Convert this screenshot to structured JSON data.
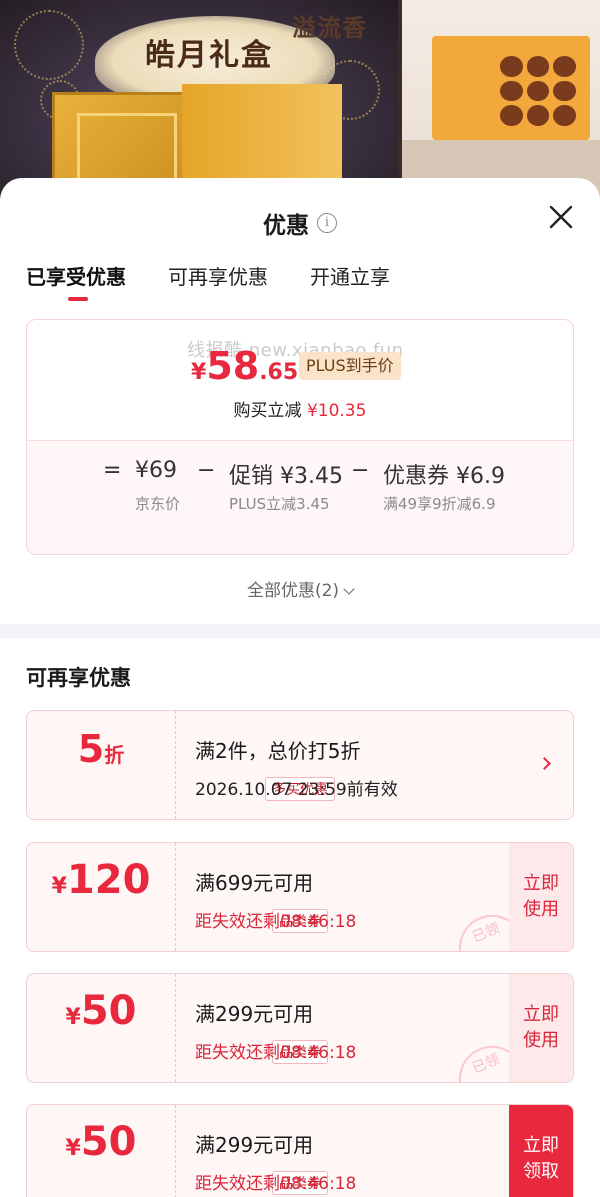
{
  "banner": {
    "title": "皓月礼盒",
    "brand": "溢流香"
  },
  "sheet": {
    "title": "优惠",
    "tabs": [
      "已享受优惠",
      "可再享优惠",
      "开通立享"
    ],
    "active_tab_index": 0
  },
  "summary": {
    "watermark": "线报酷 new.xianbao.fun",
    "currency": "¥",
    "price_int": "58",
    "price_dec": ".65",
    "plus_badge": "PLUS到手价",
    "reduce_label": "购买立减",
    "reduce_value": "¥10.35",
    "breakdown": {
      "eq": "=",
      "base_value": "¥69",
      "base_label": "京东价",
      "minus1": "−",
      "promo_value": "促销 ¥3.45",
      "promo_label": "PLUS立减3.45",
      "minus2": "−",
      "coupon_value": "优惠券 ¥6.9",
      "coupon_label": "满49享9折减6.9"
    }
  },
  "all_discounts_label": "全部优惠(2)",
  "more_section_title": "可再享优惠",
  "coupons": [
    {
      "big": "5",
      "big_unit": "折",
      "tag": "多买优惠",
      "title": "满2件，总价打5折",
      "sub": "2026.10.07 23:59前有效",
      "action": ""
    },
    {
      "big_prefix": "¥",
      "big": "120",
      "tag": "品类券",
      "title": "满699元可用",
      "sub": "距失效还剩08:46:18",
      "action": "立即使用",
      "stamp": "已领"
    },
    {
      "big_prefix": "¥",
      "big": "50",
      "tag": "品类券",
      "title": "满299元可用",
      "sub": "距失效还剩08:46:18",
      "action": "立即使用",
      "stamp": "已领"
    },
    {
      "big_prefix": "¥",
      "big": "50",
      "tag": "品类券",
      "title": "满299元可用",
      "sub": "距失效还剩08:46:18",
      "action": "立即领取"
    }
  ],
  "colors": {
    "accent": "#e8283c",
    "coupon_bg": "#fff6f6",
    "badge_bg": "#fbe3c9"
  }
}
